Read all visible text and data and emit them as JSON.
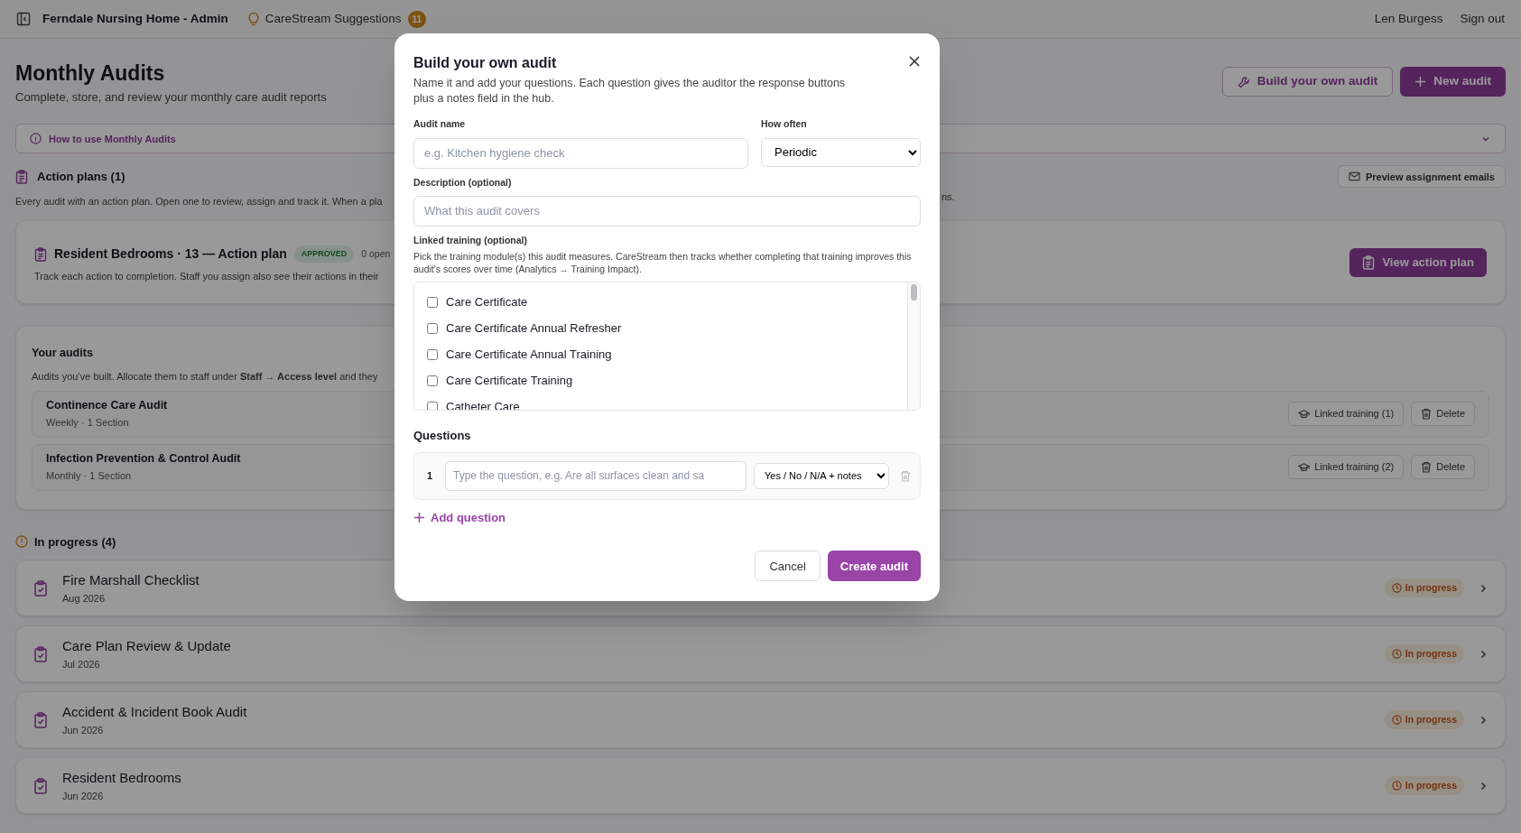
{
  "top_bar": {
    "title": "Ferndale Nursing Home - Admin",
    "suggestions": {
      "label": "CareStream Suggestions",
      "count": "11"
    },
    "user": "Len Burgess",
    "sign_out": "Sign out"
  },
  "page": {
    "title": "Monthly Audits",
    "subtitle": "Complete, store, and review your monthly care audit reports",
    "buttons": [
      {
        "kind": "outline",
        "label": "Build your own audit"
      },
      {
        "kind": "primary",
        "label": "New audit"
      }
    ]
  },
  "help_bar": {
    "label": "How to use Monthly Audits"
  },
  "action_plans": {
    "heading": "Action plans (1)",
    "description": "Every audit with an action plan. Open one to review, assign and track it. When a pla",
    "description_tail": "ns.",
    "preview_button": "Preview assignment emails",
    "cards": [
      {
        "title": "Resident Bedrooms · 13 — Action plan",
        "badge": "APPROVED",
        "open_count": "0 open",
        "description": "Track each action to completion. Staff you assign also see their actions in their",
        "button": "View action plan"
      }
    ]
  },
  "your_audits": {
    "heading": "Your audits",
    "description": "Audits you’ve built. Allocate them to staff under **Staff → Access level** and they",
    "items": [
      {
        "name": "Continence Care Audit",
        "meta": "Weekly · 1 Section",
        "training_button": "Linked training (1)",
        "delete_button": "Delete"
      },
      {
        "name": "Infection Prevention & Control Audit",
        "meta": "Monthly · 1 Section",
        "training_button": "Linked training (2)",
        "delete_button": "Delete"
      }
    ]
  },
  "in_progress": {
    "heading": "In progress (4)",
    "items": [
      {
        "title": "Fire Marshall Checklist",
        "date": "Aug 2026",
        "status": "In progress"
      },
      {
        "title": "Care Plan Review & Update",
        "date": "Jul 2026",
        "status": "In progress"
      },
      {
        "title": "Accident & Incident Book Audit",
        "date": "Jun 2026",
        "status": "In progress"
      },
      {
        "title": "Resident Bedrooms",
        "date": "Jun 2026",
        "status": "In progress"
      }
    ]
  },
  "modal": {
    "title": "Build your own audit",
    "description": "Name it and add your questions. Each question gives the auditor the response buttons plus a notes field in the hub.",
    "audit_name": {
      "label": "Audit name",
      "placeholder": "e.g. Kitchen hygiene check"
    },
    "how_often": {
      "label": "How often",
      "value": "Periodic"
    },
    "description_field": {
      "label": "Description (optional)",
      "placeholder": "What this audit covers"
    },
    "linked_training": {
      "label": "Linked training (optional)",
      "help": "Pick the training module(s) this audit measures. CareStream then tracks whether completing that training improves this audit's scores over time (Analytics → Training Impact).",
      "options": [
        {
          "label": "Care Certificate",
          "checked": false
        },
        {
          "label": "Care Certificate Annual Refresher",
          "checked": false
        },
        {
          "label": "Care Certificate Annual Training",
          "checked": false
        },
        {
          "label": "Care Certificate Training",
          "checked": false
        },
        {
          "label": "Catheter Care",
          "checked": false
        }
      ]
    },
    "questions": {
      "heading": "Questions",
      "items": [
        {
          "number": "1",
          "placeholder": "Type the question, e.g. Are all surfaces clean and sa",
          "response_type": "Yes / No / N/A + notes"
        }
      ],
      "add_label": "Add question"
    },
    "cancel": "Cancel",
    "submit": "Create audit"
  }
}
